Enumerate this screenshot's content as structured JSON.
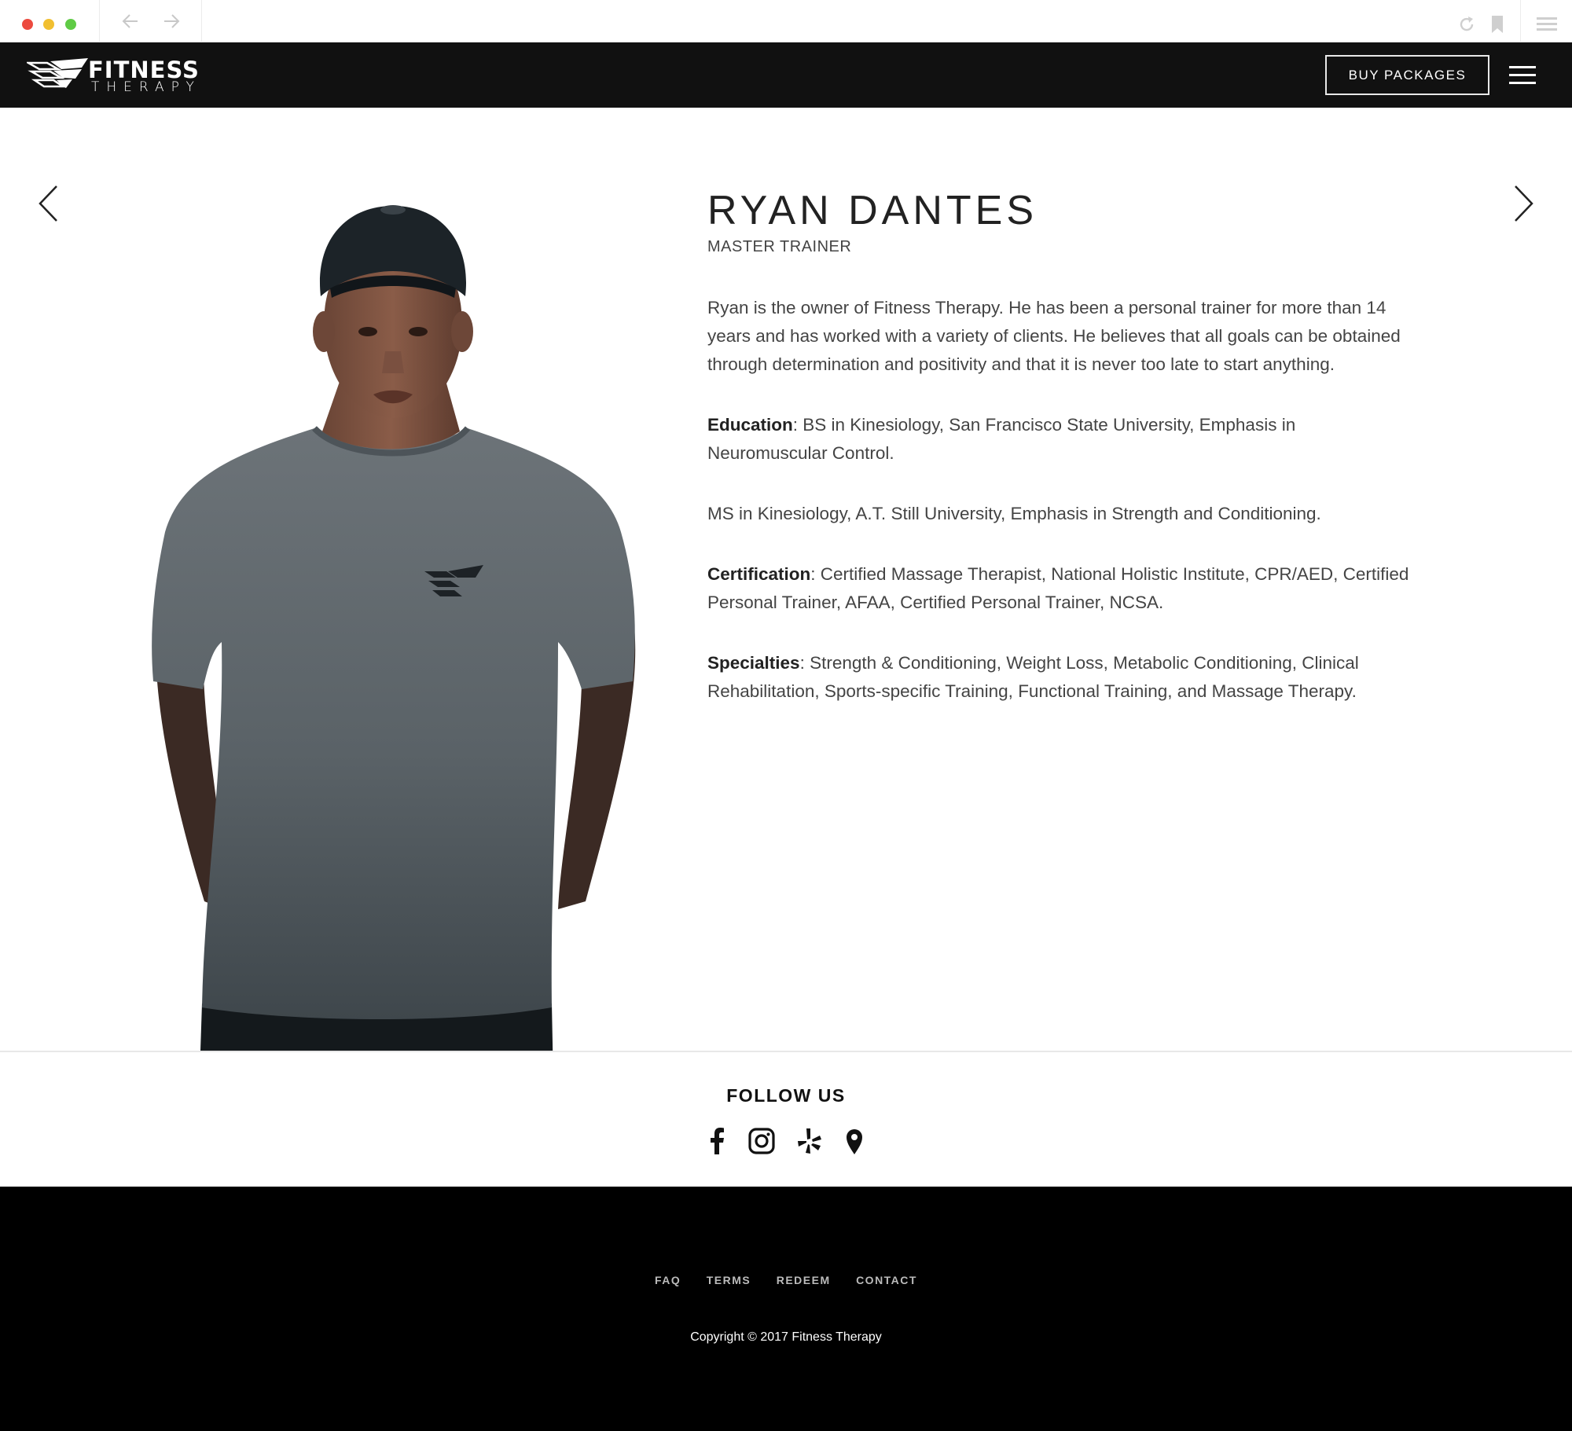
{
  "browser": {
    "icons": [
      "close-dot",
      "minimize-dot",
      "maximize-dot",
      "back-arrow-icon",
      "forward-arrow-icon",
      "reload-icon",
      "bookmark-icon",
      "browser-menu-icon"
    ],
    "colors": {
      "close": "#ec4a3f",
      "minimize": "#f1bf30",
      "maximize": "#5fcb45"
    }
  },
  "header": {
    "logo_word": "FITNESS",
    "logo_sub": "THERAPY",
    "buy_label": "BUY PACKAGES",
    "background": "#111111"
  },
  "profile": {
    "name": "RYAN DANTES",
    "role": "MASTER TRAINER",
    "intro": "Ryan is the owner of Fitness Therapy. He has been a personal trainer for more than 14 years and has worked with a variety of clients. He believes that all goals can be obtained through determination and positivity and that it is never too late to start anything.",
    "education_label": "Education",
    "education_text": ": BS in Kinesiology, San Francisco State University, Emphasis in Neuromuscular Control.",
    "ms_text": "MS in Kinesiology, A.T. Still University, Emphasis in Strength and Conditioning.",
    "certification_label": "Certification",
    "certification_text": ": Certified Massage Therapist, National Holistic Institute, CPR/AED, Certified Personal Trainer, AFAA, Certified Personal Trainer, NCSA.",
    "specialties_label": "Specialties",
    "specialties_text": ": Strength & Conditioning, Weight Loss, Metabolic Conditioning, Clinical Rehabilitation, Sports-specific Training, Functional Training, and Massage Therapy."
  },
  "follow": {
    "title": "FOLLOW US",
    "icons": [
      "facebook-icon",
      "instagram-icon",
      "yelp-icon",
      "map-pin-icon"
    ]
  },
  "footer": {
    "links": [
      "FAQ",
      "TERMS",
      "REDEEM",
      "CONTACT"
    ],
    "copyright": "Copyright © 2017 Fitness Therapy"
  }
}
